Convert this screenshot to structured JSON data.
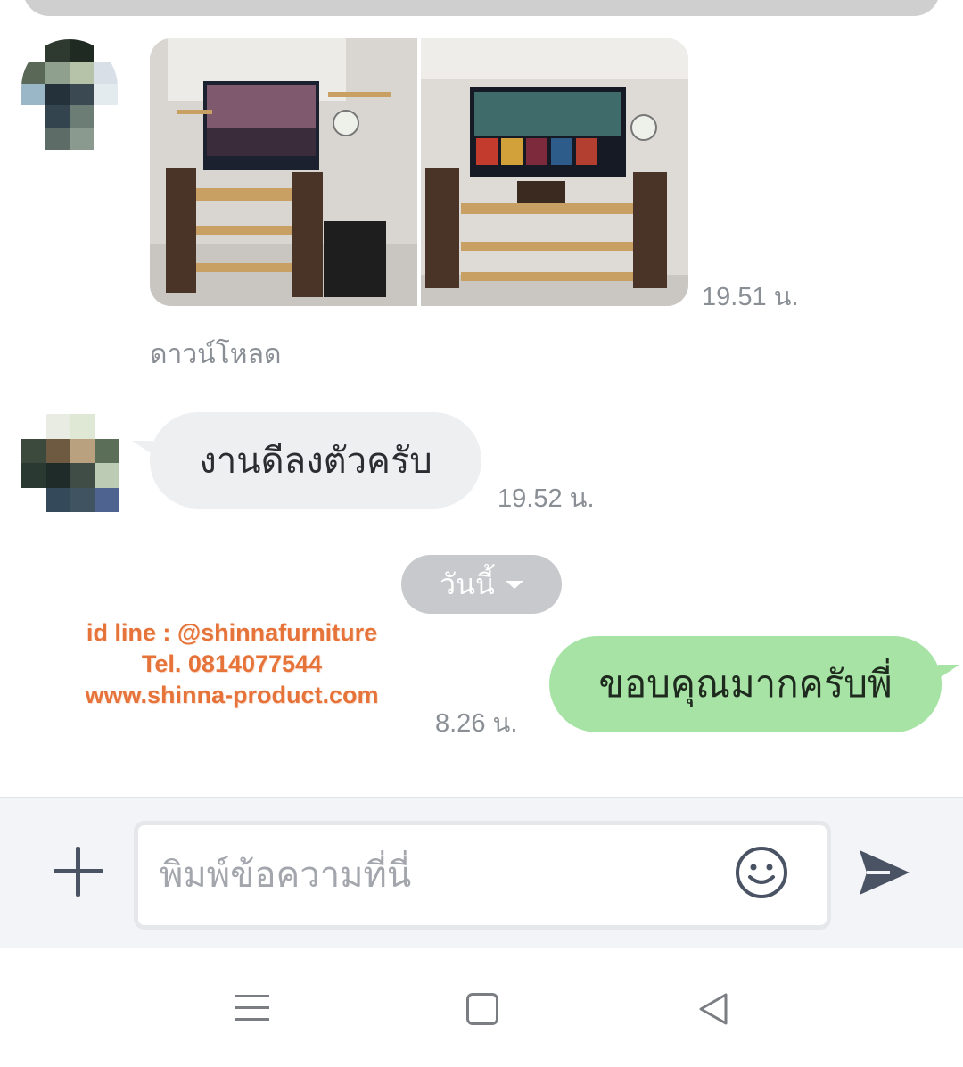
{
  "messages": [
    {
      "type": "image",
      "sender": "contact",
      "time": "19.51 น.",
      "download_label": "ดาวน์โหลด"
    },
    {
      "type": "text",
      "sender": "contact",
      "text": "งานดีลงตัวครับ",
      "time": "19.52 น."
    },
    {
      "type": "text",
      "sender": "me",
      "text": "ขอบคุณมากครับพี่",
      "time": "8.26 น."
    }
  ],
  "date_separator": {
    "label": "วันนี้"
  },
  "watermark": {
    "line1": "id line : @shinnafurniture",
    "line2": "Tel. 0814077544",
    "line3": "www.shinna-product.com"
  },
  "composer": {
    "placeholder": "พิมพ์ข้อความที่นี่"
  },
  "icons": {
    "add": "plus-icon",
    "emoji": "emoji-icon",
    "send": "send-icon",
    "nav_recent": "recent-apps-icon",
    "nav_home": "home-icon",
    "nav_back": "back-icon"
  },
  "colors": {
    "incoming_bubble": "#eeeff1",
    "outgoing_bubble": "#a7e3a5",
    "watermark": "#e5733a",
    "timestamp": "#8a8f96",
    "date_pill": "#c7c9cc"
  }
}
